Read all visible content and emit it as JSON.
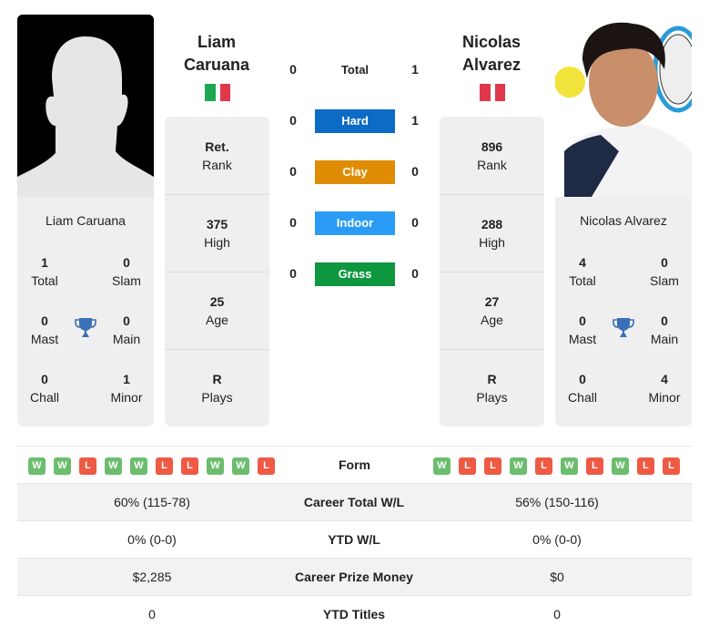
{
  "player1": {
    "name_line1": "Liam",
    "name_line2": "Caruana",
    "full_name": "Liam Caruana",
    "flag": "italy",
    "flag_colors": [
      "#1ea755",
      "#ffffff",
      "#e0384a"
    ],
    "titles": {
      "total": "1",
      "total_label": "Total",
      "slam": "0",
      "slam_label": "Slam",
      "mast": "0",
      "mast_label": "Mast",
      "main": "0",
      "main_label": "Main",
      "chall": "0",
      "chall_label": "Chall",
      "minor": "1",
      "minor_label": "Minor"
    },
    "stats": [
      {
        "value": "Ret.",
        "label": "Rank"
      },
      {
        "value": "375",
        "label": "High"
      },
      {
        "value": "25",
        "label": "Age"
      },
      {
        "value": "R",
        "label": "Plays"
      }
    ],
    "form": [
      "W",
      "W",
      "L",
      "W",
      "W",
      "L",
      "L",
      "W",
      "W",
      "L"
    ]
  },
  "player2": {
    "name_line1": "Nicolas",
    "name_line2": "Alvarez",
    "full_name": "Nicolas Alvarez",
    "flag": "peru",
    "flag_colors": [
      "#e0384a",
      "#ffffff",
      "#e0384a"
    ],
    "titles": {
      "total": "4",
      "total_label": "Total",
      "slam": "0",
      "slam_label": "Slam",
      "mast": "0",
      "mast_label": "Mast",
      "main": "0",
      "main_label": "Main",
      "chall": "0",
      "chall_label": "Chall",
      "minor": "4",
      "minor_label": "Minor"
    },
    "stats": [
      {
        "value": "896",
        "label": "Rank"
      },
      {
        "value": "288",
        "label": "High"
      },
      {
        "value": "27",
        "label": "Age"
      },
      {
        "value": "R",
        "label": "Plays"
      }
    ],
    "form": [
      "W",
      "L",
      "L",
      "W",
      "L",
      "W",
      "L",
      "W",
      "L",
      "L"
    ]
  },
  "h2h": [
    {
      "label": "Total",
      "p1": "0",
      "p2": "1",
      "color": ""
    },
    {
      "label": "Hard",
      "p1": "0",
      "p2": "1",
      "color": "#0c6bc4"
    },
    {
      "label": "Clay",
      "p1": "0",
      "p2": "0",
      "color": "#e08d05"
    },
    {
      "label": "Indoor",
      "p1": "0",
      "p2": "0",
      "color": "#2b9cf5"
    },
    {
      "label": "Grass",
      "p1": "0",
      "p2": "0",
      "color": "#0f973f"
    }
  ],
  "comparison": {
    "form_label": "Form",
    "rows": [
      {
        "label": "Career Total W/L",
        "p1": "60% (115-78)",
        "p2": "56% (150-116)"
      },
      {
        "label": "YTD W/L",
        "p1": "0% (0-0)",
        "p2": "0% (0-0)"
      },
      {
        "label": "Career Prize Money",
        "p1": "$2,285",
        "p2": "$0"
      },
      {
        "label": "YTD Titles",
        "p1": "0",
        "p2": "0"
      }
    ]
  },
  "icons": {
    "trophy": "trophy-icon"
  },
  "colors": {
    "trophy": "#3b6fb8",
    "win": "#6cbd6e",
    "loss": "#ee5a44",
    "card_bg": "#efefef"
  }
}
